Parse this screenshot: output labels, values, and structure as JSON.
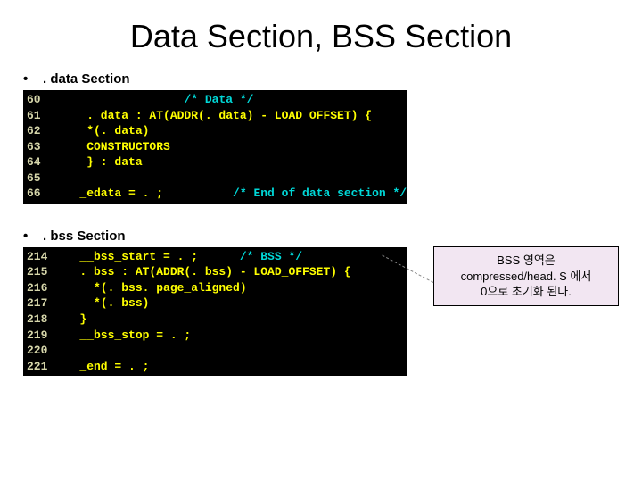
{
  "title": "Data Section, BSS Section",
  "sections": {
    "data": {
      "label": ". data Section",
      "lines": [
        {
          "num": "60",
          "pre": "                  ",
          "comment": "/* Data */",
          "post": ""
        },
        {
          "num": "61",
          "pre": "    . data : AT(ADDR(. data) - LOAD_OFFSET) {",
          "comment": "",
          "post": ""
        },
        {
          "num": "62",
          "pre": "    *(. data)",
          "comment": "",
          "post": ""
        },
        {
          "num": "63",
          "pre": "    CONSTRUCTORS",
          "comment": "",
          "post": ""
        },
        {
          "num": "64",
          "pre": "    } : data",
          "comment": "",
          "post": ""
        },
        {
          "num": "65",
          "pre": "",
          "comment": "",
          "post": ""
        },
        {
          "num": "66",
          "pre": "   _edata = . ;          ",
          "comment": "/* End of data section */",
          "post": ""
        }
      ]
    },
    "bss": {
      "label": ". bss Section",
      "lines": [
        {
          "num": "214",
          "pre": "   __bss_start = . ;      ",
          "comment": "/* BSS */",
          "post": ""
        },
        {
          "num": "215",
          "pre": "   . bss : AT(ADDR(. bss) - LOAD_OFFSET) {",
          "comment": "",
          "post": ""
        },
        {
          "num": "216",
          "pre": "     *(. bss. page_aligned)",
          "comment": "",
          "post": ""
        },
        {
          "num": "217",
          "pre": "     *(. bss)",
          "comment": "",
          "post": ""
        },
        {
          "num": "218",
          "pre": "   }",
          "comment": "",
          "post": ""
        },
        {
          "num": "219",
          "pre": "   __bss_stop = . ;",
          "comment": "",
          "post": ""
        },
        {
          "num": "220",
          "pre": "",
          "comment": "",
          "post": ""
        },
        {
          "num": "221",
          "pre": "   _end = . ;",
          "comment": "",
          "post": ""
        }
      ]
    }
  },
  "callout": {
    "line1": "BSS 영역은",
    "line2": "compressed/head. S 에서",
    "line3": "0으로 초기화 된다."
  }
}
